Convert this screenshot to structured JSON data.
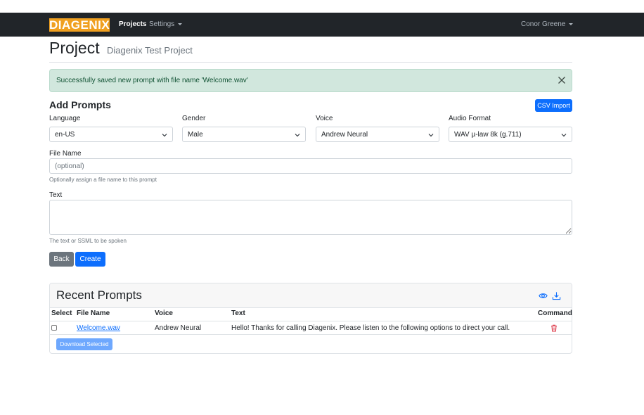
{
  "navbar": {
    "logo_text": "DIAGENIX",
    "links": [
      {
        "label": "Projects"
      },
      {
        "label": "Settings"
      }
    ],
    "user": "Conor Greene"
  },
  "page": {
    "title": "Project",
    "subtitle": "Diagenix Test Project"
  },
  "alert": {
    "message": "Successfully saved new prompt with file name 'Welcome.wav'"
  },
  "add_prompts": {
    "title": "Add Prompts",
    "csv_import_label": "CSV Import",
    "fields": {
      "language": {
        "label": "Language",
        "value": "en-US"
      },
      "gender": {
        "label": "Gender",
        "value": "Male"
      },
      "voice": {
        "label": "Voice",
        "value": "Andrew Neural"
      },
      "audio_format": {
        "label": "Audio Format",
        "value": "WAV µ-law 8k (g.711)"
      }
    },
    "file_name": {
      "label": "File Name",
      "placeholder": "(optional)",
      "help": "Optionally assign a file name to this prompt"
    },
    "text": {
      "label": "Text",
      "help": "The text or SSML to be spoken"
    },
    "back_label": "Back",
    "create_label": "Create"
  },
  "recent_prompts": {
    "title": "Recent Prompts",
    "columns": [
      "Select",
      "File Name",
      "Voice",
      "Text",
      "Command"
    ],
    "rows": [
      {
        "file_name": "Welcome.wav",
        "voice": "Andrew Neural",
        "text": "Hello! Thanks for calling Diagenix. Please listen to the following options to direct your call."
      }
    ],
    "download_label": "Download Selected"
  },
  "colors": {
    "navbar": "#212529",
    "logo": "#f0a020",
    "primary": "#0d6efd",
    "secondary": "#6c757d",
    "success_bg": "#d1e7dd",
    "danger": "#dc3545"
  },
  "icons": {
    "alert_close": "close-icon",
    "preview": "eye-icon",
    "download": "download-icon",
    "delete": "trash-icon",
    "select_arrow": "chevron-down-icon"
  }
}
